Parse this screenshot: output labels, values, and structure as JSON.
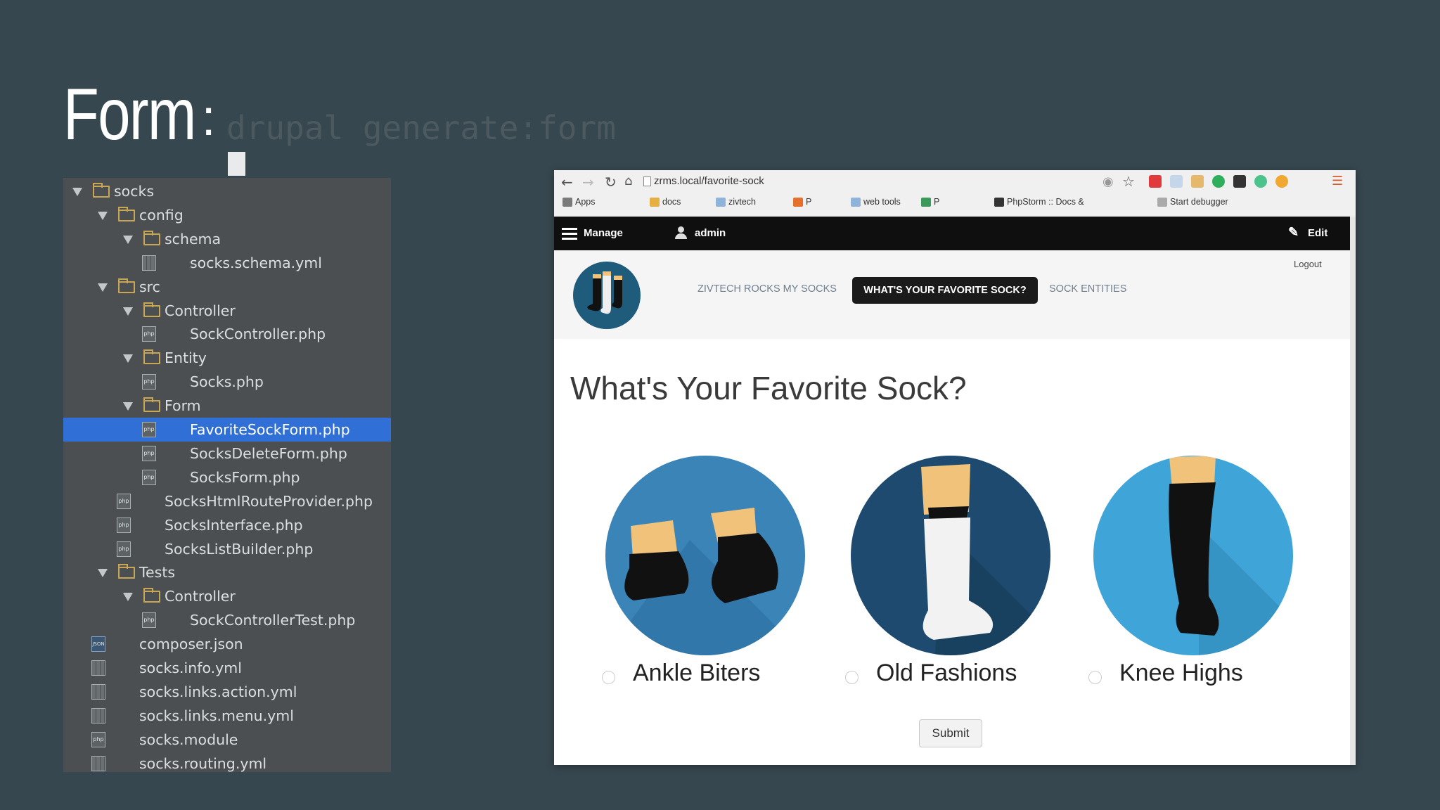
{
  "slide": {
    "title": "Form",
    "colon": ":",
    "command": "drupal generate:form"
  },
  "tree": {
    "items": [
      {
        "label": "socks",
        "type": "folder",
        "depth": 0,
        "expanded": true
      },
      {
        "label": "config",
        "type": "folder",
        "depth": 1,
        "expanded": true
      },
      {
        "label": "schema",
        "type": "folder",
        "depth": 2,
        "expanded": true
      },
      {
        "label": "socks.schema.yml",
        "type": "yml",
        "depth": 3
      },
      {
        "label": "src",
        "type": "folder",
        "depth": 1,
        "expanded": true
      },
      {
        "label": "Controller",
        "type": "folder",
        "depth": 2,
        "expanded": true
      },
      {
        "label": "SockController.php",
        "type": "php",
        "depth": 3
      },
      {
        "label": "Entity",
        "type": "folder",
        "depth": 2,
        "expanded": true
      },
      {
        "label": "Socks.php",
        "type": "php",
        "depth": 3
      },
      {
        "label": "Form",
        "type": "folder",
        "depth": 2,
        "expanded": true
      },
      {
        "label": "FavoriteSockForm.php",
        "type": "php",
        "depth": 3,
        "selected": true
      },
      {
        "label": "SocksDeleteForm.php",
        "type": "php",
        "depth": 3
      },
      {
        "label": "SocksForm.php",
        "type": "php",
        "depth": 3
      },
      {
        "label": "SocksHtmlRouteProvider.php",
        "type": "php",
        "depth": 2
      },
      {
        "label": "SocksInterface.php",
        "type": "php",
        "depth": 2
      },
      {
        "label": "SocksListBuilder.php",
        "type": "php",
        "depth": 2
      },
      {
        "label": "Tests",
        "type": "folder",
        "depth": 1,
        "expanded": true
      },
      {
        "label": "Controller",
        "type": "folder",
        "depth": 2,
        "expanded": true
      },
      {
        "label": "SockControllerTest.php",
        "type": "php",
        "depth": 3
      },
      {
        "label": "composer.json",
        "type": "json",
        "depth": 1
      },
      {
        "label": "socks.info.yml",
        "type": "yml",
        "depth": 1
      },
      {
        "label": "socks.links.action.yml",
        "type": "yml",
        "depth": 1
      },
      {
        "label": "socks.links.menu.yml",
        "type": "yml",
        "depth": 1
      },
      {
        "label": "socks.module",
        "type": "php",
        "depth": 1
      },
      {
        "label": "socks.routing.yml",
        "type": "yml",
        "depth": 1
      }
    ]
  },
  "browser": {
    "url": "zrms.local/favorite-sock",
    "bookmarks": [
      "Apps",
      "docs",
      "zivtech",
      "P",
      "web tools",
      "P",
      "PhpStorm :: Docs &",
      "Start debugger"
    ]
  },
  "toolbar": {
    "manage": "Manage",
    "user": "admin",
    "edit": "Edit"
  },
  "site": {
    "logout": "Logout",
    "nav": [
      "ZIVTECH ROCKS MY SOCKS",
      "WHAT'S YOUR FAVORITE SOCK?",
      "SOCK ENTITIES"
    ]
  },
  "form": {
    "heading": "What's Your Favorite Sock?",
    "options": [
      {
        "label": "Ankle Biters",
        "bg": "#3a84b8"
      },
      {
        "label": "Old Fashions",
        "bg": "#1d4a6e"
      },
      {
        "label": "Knee Highs",
        "bg": "#3fa5d8"
      }
    ],
    "submit": "Submit"
  },
  "colors": {
    "selection": "#2f6fd6",
    "background": "#37474f",
    "panel": "#4b4f51"
  }
}
